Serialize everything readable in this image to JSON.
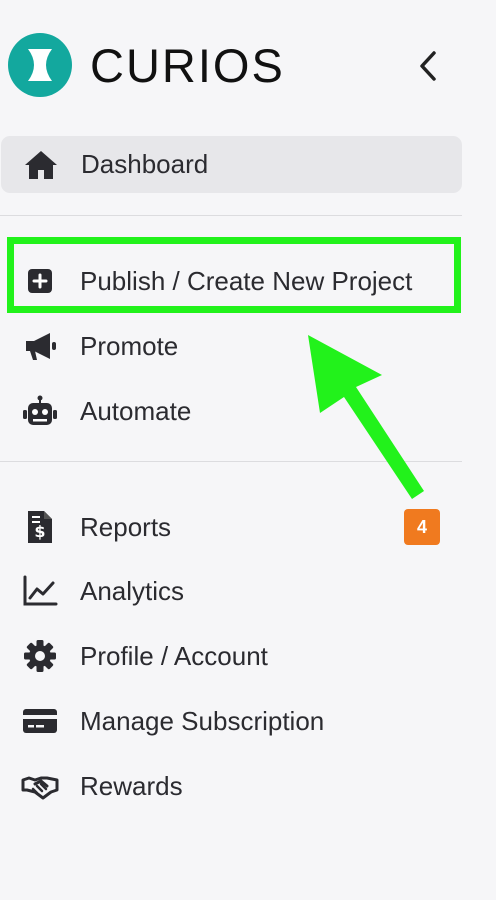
{
  "brand": {
    "name": "CURIOS",
    "color": "#13a89e"
  },
  "header": {
    "collapse_icon": "chevron-left-icon"
  },
  "nav": {
    "dashboard": {
      "label": "Dashboard",
      "icon": "home-icon",
      "active": true
    },
    "publish": {
      "label": "Publish / Create New Project",
      "icon": "plus-square-icon"
    },
    "promote": {
      "label": "Promote",
      "icon": "megaphone-icon"
    },
    "automate": {
      "label": "Automate",
      "icon": "robot-icon"
    },
    "reports": {
      "label": "Reports",
      "icon": "invoice-dollar-icon",
      "badge": "4"
    },
    "analytics": {
      "label": "Analytics",
      "icon": "line-chart-icon"
    },
    "profile": {
      "label": "Profile / Account",
      "icon": "gear-icon"
    },
    "subscription": {
      "label": "Manage Subscription",
      "icon": "credit-card-icon"
    },
    "rewards": {
      "label": "Rewards",
      "icon": "handshake-icon"
    }
  },
  "annotation": {
    "highlight_color": "#22f21b",
    "badge_color": "#f07a1f"
  }
}
